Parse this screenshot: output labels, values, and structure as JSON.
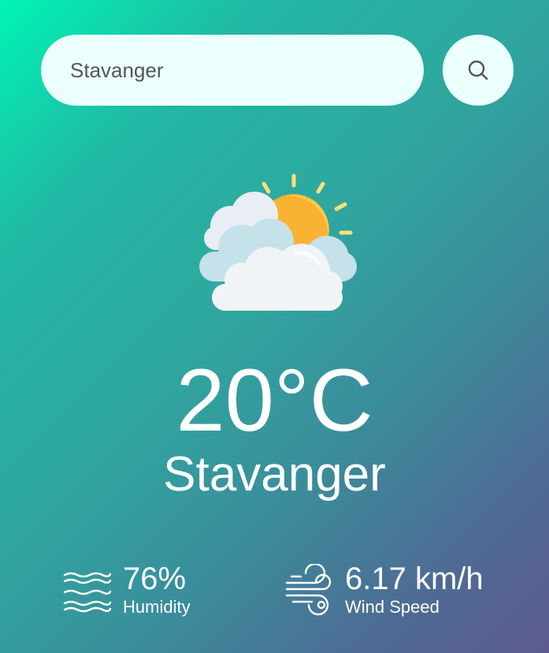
{
  "search": {
    "value": "Stavanger",
    "placeholder": "",
    "button_icon": "search-icon"
  },
  "weather": {
    "icon": "partly-cloudy-icon",
    "temperature": "20°C",
    "city": "Stavanger"
  },
  "details": {
    "humidity": {
      "icon": "humidity-waves-icon",
      "value": "76%",
      "label": "Humidity"
    },
    "wind": {
      "icon": "wind-icon",
      "value": "6.17 km/h",
      "label": "Wind Speed"
    }
  },
  "colors": {
    "gradient_start": "#00f5b4",
    "gradient_end": "#5d5a90",
    "input_background": "#ebfffc",
    "text": "#ffffff"
  }
}
